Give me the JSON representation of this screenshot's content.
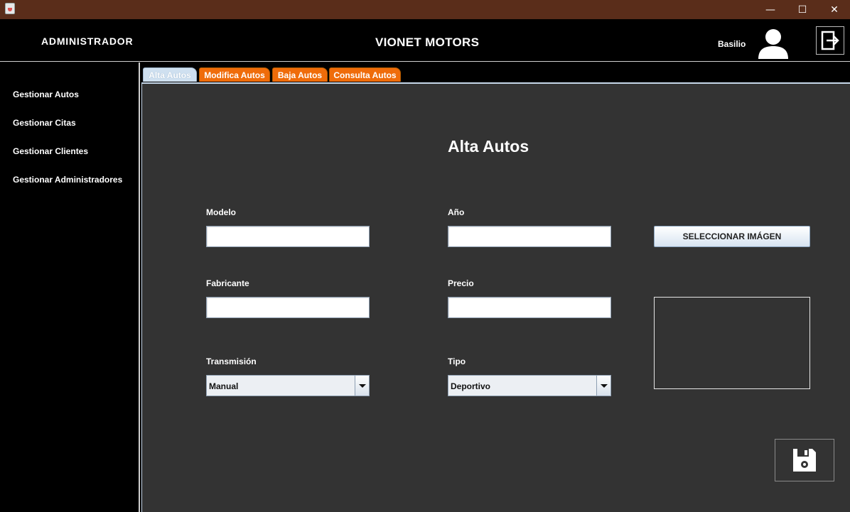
{
  "window": {
    "minimize_glyph": "—",
    "maximize_glyph": "☐",
    "close_glyph": "✕"
  },
  "header": {
    "role": "ADMINISTRADOR",
    "app_title": "VIONET MOTORS",
    "user_name": "Basilio",
    "avatar_icon": "user-icon",
    "logout_icon": "logout-icon"
  },
  "sidebar": {
    "items": [
      {
        "label": "Gestionar Autos"
      },
      {
        "label": "Gestionar Citas"
      },
      {
        "label": "Gestionar Clientes"
      },
      {
        "label": "Gestionar Administradores"
      }
    ]
  },
  "tabs": [
    {
      "label": "Alta Autos",
      "active": true
    },
    {
      "label": "Modifica Autos",
      "active": false
    },
    {
      "label": "Baja Autos",
      "active": false
    },
    {
      "label": "Consulta Autos",
      "active": false
    }
  ],
  "form": {
    "title": "Alta Autos",
    "modelo": {
      "label": "Modelo",
      "value": ""
    },
    "anio": {
      "label": "Año",
      "value": ""
    },
    "fabricante": {
      "label": "Fabricante",
      "value": ""
    },
    "precio": {
      "label": "Precio",
      "value": ""
    },
    "transmision": {
      "label": "Transmisión",
      "selected": "Manual"
    },
    "tipo": {
      "label": "Tipo",
      "selected": "Deportivo"
    },
    "select_image_label": "SELECCIONAR IMÁGEN",
    "save_icon": "floppy-disk-icon"
  },
  "colors": {
    "titlebar": "#5a2d1a",
    "panel": "#333333",
    "tab_orange": "#ef6c0a",
    "tab_active": "#cfe0f0"
  }
}
